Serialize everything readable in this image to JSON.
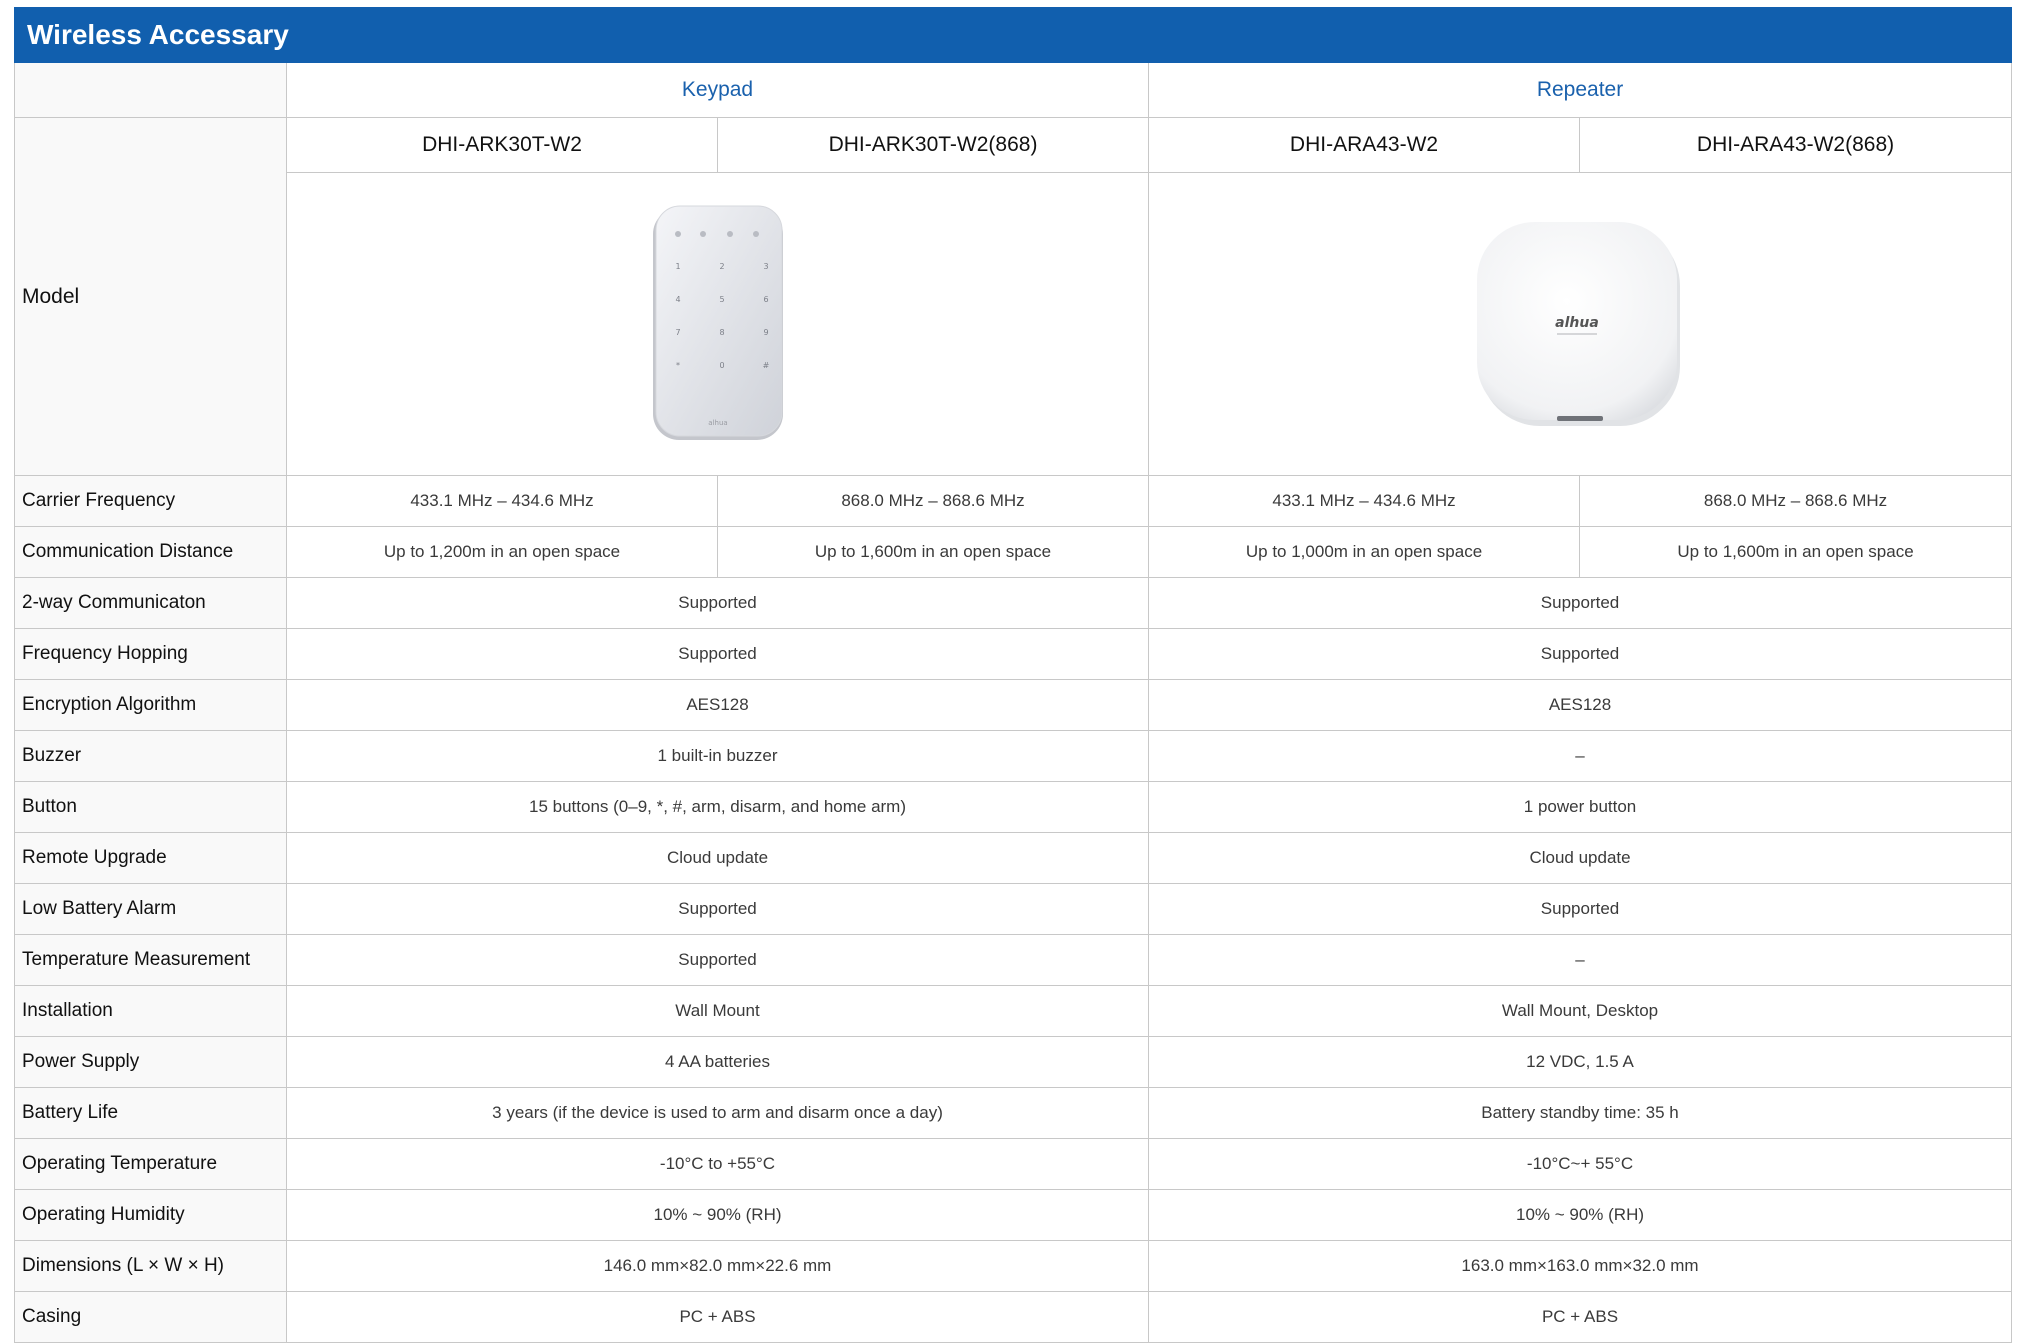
{
  "title": "Wireless Accessary",
  "categories": {
    "keypad": "Keypad",
    "repeater": "Repeater"
  },
  "model_label": "Model",
  "models": [
    "DHI-ARK30T-W2",
    "DHI-ARK30T-W2(868)",
    "DHI-ARA43-W2",
    "DHI-ARA43-W2(868)"
  ],
  "images": {
    "keypad": {
      "icon": "keypad-device-image",
      "keys": [
        "1",
        "2",
        "3",
        "4",
        "5",
        "6",
        "7",
        "8",
        "9",
        "*",
        "0",
        "#"
      ]
    },
    "repeater": {
      "icon": "repeater-device-image",
      "logo": "alhua"
    }
  },
  "split_rows": [
    {
      "label": "Carrier Frequency",
      "values": [
        "433.1 MHz – 434.6 MHz",
        "868.0 MHz – 868.6 MHz",
        "433.1 MHz – 434.6 MHz",
        "868.0 MHz – 868.6 MHz"
      ]
    },
    {
      "label": "Communication Distance",
      "values": [
        "Up to 1,200m in an open space",
        "Up to 1,600m in an open space",
        "Up to 1,000m in an open space",
        "Up to 1,600m in an open space"
      ]
    }
  ],
  "rows": [
    {
      "label": "2-way Communicaton",
      "keypad": "Supported",
      "repeater": "Supported"
    },
    {
      "label": "Frequency Hopping",
      "keypad": "Supported",
      "repeater": "Supported"
    },
    {
      "label": "Encryption Algorithm",
      "keypad": "AES128",
      "repeater": "AES128"
    },
    {
      "label": "Buzzer",
      "keypad": "1  built-in buzzer",
      "repeater": "–"
    },
    {
      "label": "Button",
      "keypad": "15 buttons (0–9, *, #, arm, disarm, and home arm)",
      "repeater": "1 power button"
    },
    {
      "label": "Remote Upgrade",
      "keypad": "Cloud update",
      "repeater": "Cloud update"
    },
    {
      "label": "Low Battery Alarm",
      "keypad": "Supported",
      "repeater": "Supported"
    },
    {
      "label": "Temperature Measurement",
      "keypad": "Supported",
      "repeater": "–"
    },
    {
      "label": "Installation",
      "keypad": "Wall Mount",
      "repeater": "Wall Mount, Desktop"
    },
    {
      "label": "Power Supply",
      "keypad": "4 AA batteries",
      "repeater": "12 VDC, 1.5 A"
    },
    {
      "label": "Battery Life",
      "keypad": "3 years (if the device is used to arm and disarm once a day)",
      "repeater": "Battery standby time: 35 h"
    },
    {
      "label": "Operating Temperature",
      "keypad": "-10°C to +55°C",
      "repeater": "-10°C~+ 55°C"
    },
    {
      "label": "Operating Humidity",
      "keypad": "10% ~ 90% (RH)",
      "repeater": "10% ~ 90% (RH)"
    },
    {
      "label": "Dimensions (L × W × H)",
      "keypad": "146.0 mm×82.0 mm×22.6 mm",
      "repeater": "163.0 mm×163.0 mm×32.0 mm"
    },
    {
      "label": "Casing",
      "keypad": "PC + ABS",
      "repeater": "PC + ABS"
    }
  ]
}
